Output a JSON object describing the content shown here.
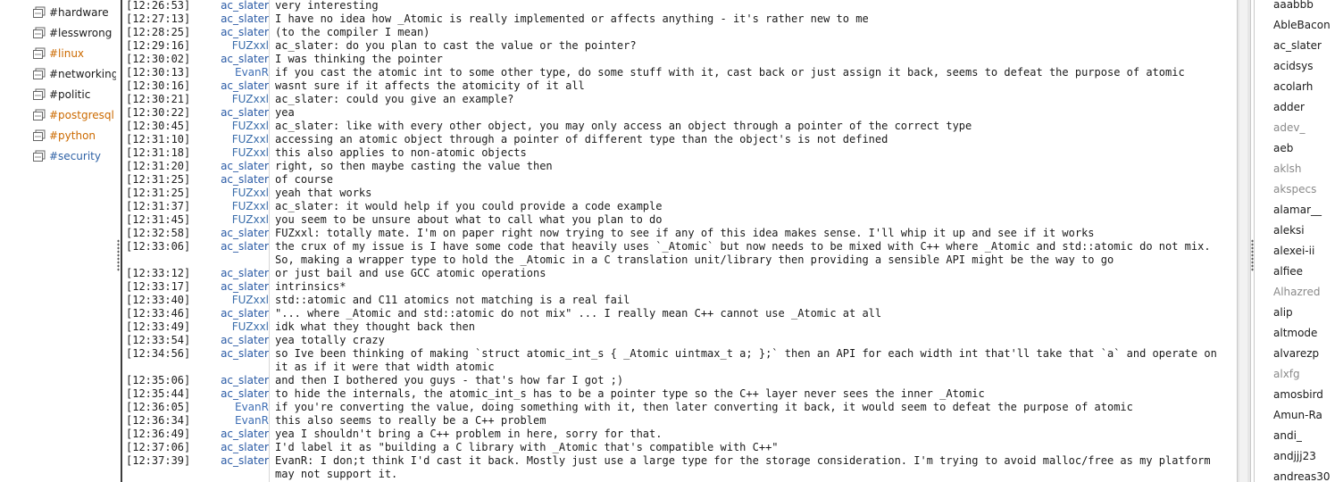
{
  "colors": {
    "channel_default": "#1a1a1a",
    "channel_activity": "#cc6a00",
    "channel_highlight": "#2f62a6",
    "nick_ac_slater": "#2a5aa5",
    "nick_FUZxxl": "#3b6eab",
    "nick_EvanR": "#3f6fb5",
    "user_here": "#1a1a1a",
    "user_away": "#8a8a8a"
  },
  "channels": [
    {
      "name": "#hardware",
      "state": "default"
    },
    {
      "name": "#lesswrong",
      "state": "default"
    },
    {
      "name": "#linux",
      "state": "activity"
    },
    {
      "name": "#networking",
      "state": "default"
    },
    {
      "name": "#politic",
      "state": "default"
    },
    {
      "name": "#postgresql",
      "state": "activity"
    },
    {
      "name": "#python",
      "state": "activity"
    },
    {
      "name": "#security",
      "state": "highlight"
    }
  ],
  "messages": [
    {
      "time": "[12:26:53]",
      "nick": "ac_slater",
      "text": "very interesting"
    },
    {
      "time": "[12:27:13]",
      "nick": "ac_slater",
      "text": "I have no idea how _Atomic is really implemented or affects anything - it's rather new to me"
    },
    {
      "time": "[12:28:25]",
      "nick": "ac_slater",
      "text": "(to the compiler I mean)"
    },
    {
      "time": "[12:29:16]",
      "nick": "FUZxxl",
      "text": "ac_slater: do you plan to cast the value or the pointer?"
    },
    {
      "time": "[12:30:02]",
      "nick": "ac_slater",
      "text": "I was thinking the pointer"
    },
    {
      "time": "[12:30:13]",
      "nick": "EvanR",
      "text": "if you cast the atomic int to some other type, do some stuff with it, cast back or just assign it back, seems to defeat the purpose of atomic"
    },
    {
      "time": "[12:30:16]",
      "nick": "ac_slater",
      "text": "wasnt sure if it affects the atomicity of it all"
    },
    {
      "time": "[12:30:21]",
      "nick": "FUZxxl",
      "text": "ac_slater: could you give an example?"
    },
    {
      "time": "[12:30:22]",
      "nick": "ac_slater",
      "text": "yea"
    },
    {
      "time": "[12:30:45]",
      "nick": "FUZxxl",
      "text": "ac_slater: like with every other object, you may only access an object through a pointer of the correct type"
    },
    {
      "time": "[12:31:10]",
      "nick": "FUZxxl",
      "text": "accessing an atomic object through a pointer of different type than the object's is not defined"
    },
    {
      "time": "[12:31:18]",
      "nick": "FUZxxl",
      "text": "this also applies to non-atomic objects"
    },
    {
      "time": "[12:31:20]",
      "nick": "ac_slater",
      "text": "right, so then maybe casting the value then"
    },
    {
      "time": "[12:31:25]",
      "nick": "ac_slater",
      "text": "of course"
    },
    {
      "time": "[12:31:25]",
      "nick": "FUZxxl",
      "text": "yeah that works"
    },
    {
      "time": "[12:31:37]",
      "nick": "FUZxxl",
      "text": "ac_slater: it would help if you could provide a code example"
    },
    {
      "time": "[12:31:45]",
      "nick": "FUZxxl",
      "text": "you seem to be unsure about what to call what you plan to do"
    },
    {
      "time": "[12:32:58]",
      "nick": "ac_slater",
      "text": "FUZxxl: totally mate. I'm on paper right now trying to see if any of this idea makes sense. I'll whip it up and see if it works"
    },
    {
      "time": "[12:33:06]",
      "nick": "ac_slater",
      "text": "the crux of my issue is I have some code that heavily uses `_Atomic` but now needs to be mixed with C++ where _Atomic and std::atomic do not mix. So, making a wrapper type to hold the _Atomic in a C translation unit/library then providing a sensible API might be the way to go"
    },
    {
      "time": "[12:33:12]",
      "nick": "ac_slater",
      "text": "or just bail and use GCC atomic operations"
    },
    {
      "time": "[12:33:17]",
      "nick": "ac_slater",
      "text": "intrinsics*"
    },
    {
      "time": "[12:33:40]",
      "nick": "FUZxxl",
      "text": "std::atomic and C11 atomics not matching is a real fail"
    },
    {
      "time": "[12:33:46]",
      "nick": "ac_slater",
      "text": "\"... where _Atomic and std::atomic do not mix\" ... I really mean C++ cannot use _Atomic at all"
    },
    {
      "time": "[12:33:49]",
      "nick": "FUZxxl",
      "text": "idk what they thought back then"
    },
    {
      "time": "[12:33:54]",
      "nick": "ac_slater",
      "text": "yea totally crazy"
    },
    {
      "time": "[12:34:56]",
      "nick": "ac_slater",
      "text": "so Ive been thinking of making `struct atomic_int_s { _Atomic uintmax_t a; };` then an API for each width int that'll take that `a` and operate on it as if it were that width atomic"
    },
    {
      "time": "[12:35:06]",
      "nick": "ac_slater",
      "text": "and then I bothered you guys - that's how far I got ;)"
    },
    {
      "time": "[12:35:44]",
      "nick": "ac_slater",
      "text": "to hide the internals, the atomic_int_s has to be a pointer type so the C++ layer never sees the inner _Atomic"
    },
    {
      "time": "[12:36:05]",
      "nick": "EvanR",
      "text": "if you're converting the value, doing something with it, then later converting it back, it would seem to defeat the purpose of atomic"
    },
    {
      "time": "[12:36:34]",
      "nick": "EvanR",
      "text": "this also seems to really be a C++ problem"
    },
    {
      "time": "[12:36:49]",
      "nick": "ac_slater",
      "text": "yea I shouldn't bring a C++ problem in here, sorry for that."
    },
    {
      "time": "[12:37:06]",
      "nick": "ac_slater",
      "text": "I'd label it as \"building a C library with _Atomic that's compatible with C++\""
    },
    {
      "time": "[12:37:39]",
      "nick": "ac_slater",
      "text": "EvanR: I don;t think I'd cast it back. Mostly just use a large type for the storage consideration. I'm trying to avoid malloc/free as my platform may not support it."
    }
  ],
  "users": [
    {
      "name": "aaabbb",
      "away": false
    },
    {
      "name": "AbleBacon",
      "away": false
    },
    {
      "name": "ac_slater",
      "away": false
    },
    {
      "name": "acidsys",
      "away": false
    },
    {
      "name": "acolarh",
      "away": false
    },
    {
      "name": "adder",
      "away": false
    },
    {
      "name": "adev_",
      "away": true
    },
    {
      "name": "aeb",
      "away": false
    },
    {
      "name": "aklsh",
      "away": true
    },
    {
      "name": "akspecs",
      "away": true
    },
    {
      "name": "alamar__",
      "away": false
    },
    {
      "name": "aleksi",
      "away": false
    },
    {
      "name": "alexei-ii",
      "away": false
    },
    {
      "name": "alfiee",
      "away": false
    },
    {
      "name": "Alhazred",
      "away": true
    },
    {
      "name": "alip",
      "away": false
    },
    {
      "name": "altmode",
      "away": false
    },
    {
      "name": "alvarezp",
      "away": false
    },
    {
      "name": "alxfg",
      "away": true
    },
    {
      "name": "amosbird",
      "away": false
    },
    {
      "name": "Amun-Ra",
      "away": false
    },
    {
      "name": "andi_",
      "away": false
    },
    {
      "name": "andjjj23",
      "away": false
    },
    {
      "name": "andreas30",
      "away": false
    }
  ]
}
